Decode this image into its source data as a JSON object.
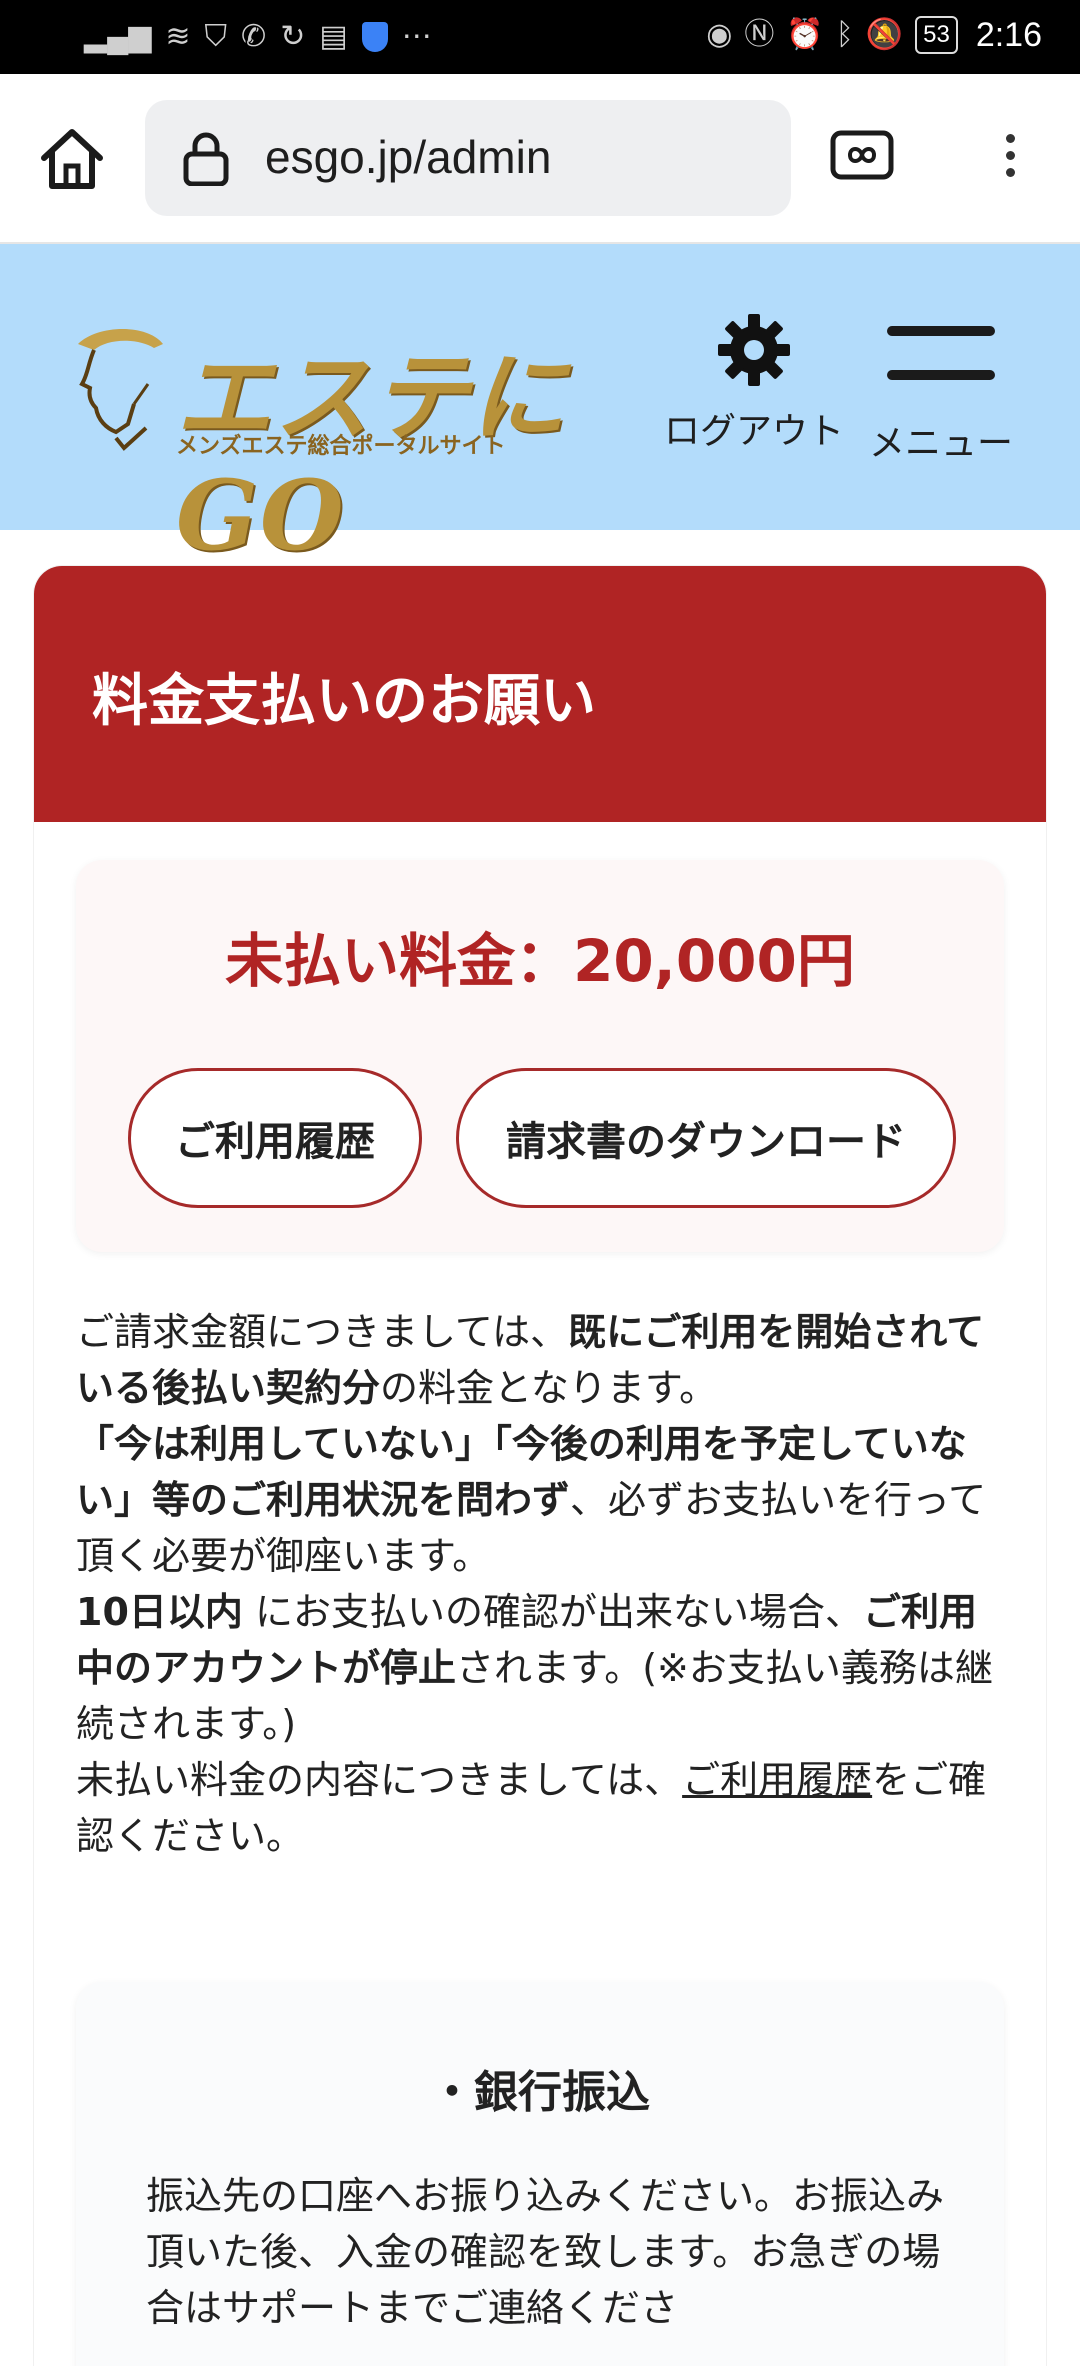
{
  "status_bar": {
    "time": "2:16",
    "battery": "53",
    "icons_left": [
      "signal-icon",
      "wifi-icon",
      "shield-icon",
      "hd-call-icon",
      "sync-icon",
      "sim-icon",
      "vpn-icon",
      "more-icon"
    ],
    "icons_right": [
      "eye-icon",
      "nfc-icon",
      "alarm-icon",
      "bluetooth-icon",
      "mute-icon"
    ],
    "more_glyph": "⋯"
  },
  "browser": {
    "url": "esgo.jp/admin"
  },
  "site_header": {
    "logo_title": "エステにGO",
    "logo_subtitle": "メンズエステ総合ポータルサイト",
    "logout_label": "ログアウト",
    "menu_label": "メニュー"
  },
  "payment": {
    "title": "料金支払いのお願い",
    "unpaid_amount": "未払い料金：20,000円",
    "history_button": "ご利用履歴",
    "download_button": "請求書のダウンロード",
    "notice": {
      "p1_a": "ご請求金額につきましては、",
      "p1_b": "既にご利用を開始されている後払い契約分",
      "p1_c": "の料金となります。",
      "p2_a": "「今は利用していない」「今後の利用を予定していない」等のご利用状況を問わず",
      "p2_b": "、必ずお支払いを行って頂く必要が御座います。",
      "p3_a": "10日以内",
      "p3_b": " にお支払いの確認が出来ない場合、",
      "p3_c": "ご利用中のアカウントが停止",
      "p3_d": "されます。(※お支払い義務は継続されます。)",
      "p4_a": "未払い料金の内容につきましては、",
      "p4_link": "ご利用履歴",
      "p4_b": "をご確認ください。"
    }
  },
  "bank": {
    "title": "・銀行振込",
    "text": "振込先の口座へお振り込みください。お振込み頂いた後、入金の確認を致します。お急ぎの場合はサポートまでご連絡くださ"
  }
}
